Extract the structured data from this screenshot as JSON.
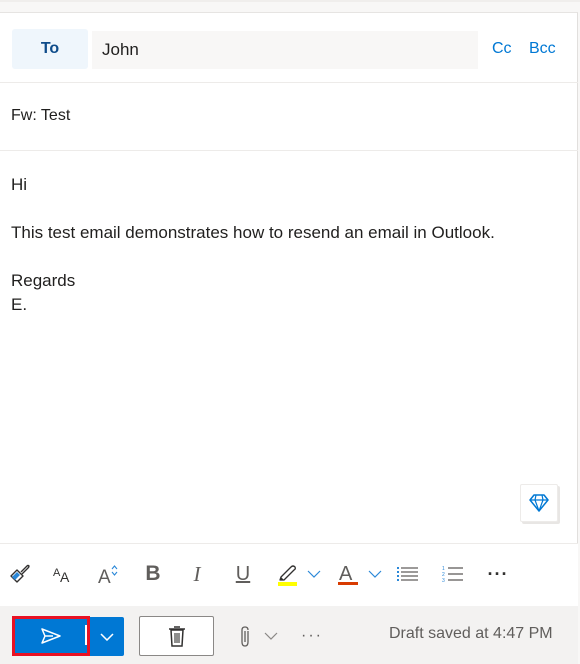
{
  "compose": {
    "to_label": "To",
    "to_value": "John",
    "cc_label": "Cc",
    "bcc_label": "Bcc",
    "subject": "Fw: Test",
    "body_lines": [
      "Hi",
      "",
      "This test email demonstrates how to resend an email in Outlook.",
      "",
      "Regards",
      "E."
    ]
  },
  "body_tools": {
    "editor_icon": "diamond-icon"
  },
  "format_toolbar": {
    "items": [
      {
        "name": "format-painter",
        "icon": "paintbrush-icon"
      },
      {
        "name": "font-size",
        "icon": "font-size-icon"
      },
      {
        "name": "grow-font",
        "icon": "grow-font-icon"
      },
      {
        "name": "bold",
        "icon": "bold-icon",
        "glyph": "B"
      },
      {
        "name": "italic",
        "icon": "italic-icon",
        "glyph": "I"
      },
      {
        "name": "underline",
        "icon": "underline-icon",
        "glyph": "U"
      },
      {
        "name": "highlight",
        "icon": "highlighter-icon",
        "color": "#ffff00"
      },
      {
        "name": "font-color",
        "icon": "font-color-icon",
        "glyph": "A",
        "color": "#d83b01"
      },
      {
        "name": "bullets",
        "icon": "bullet-list-icon"
      },
      {
        "name": "numbering",
        "icon": "numbered-list-icon"
      },
      {
        "name": "more-formatting",
        "icon": "more-icon",
        "glyph": "···"
      }
    ]
  },
  "actions": {
    "send_icon": "send-icon",
    "more_glyph": "···",
    "draft_status": "Draft saved at 4:47 PM"
  },
  "colors": {
    "accent": "#0078d4",
    "highlight_box": "#e81123"
  }
}
